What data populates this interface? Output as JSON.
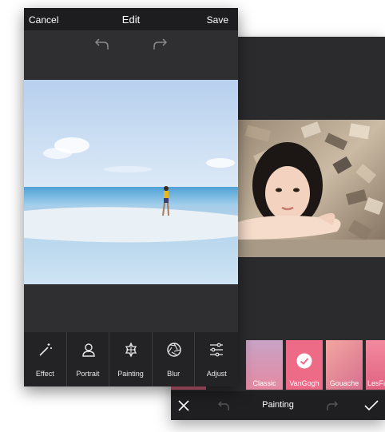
{
  "front": {
    "header": {
      "cancel": "Cancel",
      "title": "Edit",
      "save": "Save"
    },
    "tools": [
      {
        "label": "Effect",
        "icon": "magic-wand-icon"
      },
      {
        "label": "Portrait",
        "icon": "person-icon"
      },
      {
        "label": "Painting",
        "icon": "painting-icon"
      },
      {
        "label": "Blur",
        "icon": "aperture-icon"
      },
      {
        "label": "Adjust",
        "icon": "sliders-icon"
      }
    ]
  },
  "back": {
    "filters": [
      {
        "label": "Classic"
      },
      {
        "label": "VanGogh",
        "selected": true
      },
      {
        "label": "Gouache"
      },
      {
        "label": "LesFan"
      }
    ],
    "bottom_title": "Painting"
  },
  "colors": {
    "bar": "#1d1d1f",
    "panel": "#2f2f31",
    "accent": "#ffffff"
  }
}
